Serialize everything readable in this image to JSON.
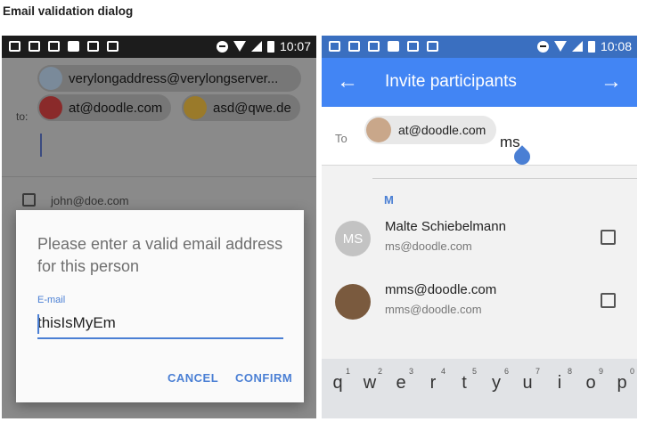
{
  "page_heading": "Email validation dialog",
  "left": {
    "status_time": "10:07",
    "chips": [
      "verylongaddress@verylongserver...",
      "at@doodle.com",
      "asd@qwe.de"
    ],
    "to_label": "to:",
    "background_email": "john@doe.com",
    "dialog": {
      "message": "Please enter a valid email address for this person",
      "field_label": "E-mail",
      "field_value": "thisIsMyEm",
      "cancel": "CANCEL",
      "confirm": "CONFIRM"
    }
  },
  "right": {
    "status_time": "10:08",
    "title": "Invite participants",
    "to_label": "To",
    "chip": "at@doodle.com",
    "typed_text": "ms",
    "section_letter": "M",
    "contacts": [
      {
        "initials": "MS",
        "name": "Malte Schiebelmann",
        "email": "ms@doodle.com"
      },
      {
        "initials": "",
        "name": "mms@doodle.com",
        "email": "mms@doodle.com"
      }
    ],
    "keys": [
      {
        "num": "1",
        "ch": "q"
      },
      {
        "num": "2",
        "ch": "w"
      },
      {
        "num": "3",
        "ch": "e"
      },
      {
        "num": "4",
        "ch": "r"
      },
      {
        "num": "5",
        "ch": "t"
      },
      {
        "num": "6",
        "ch": "y"
      },
      {
        "num": "7",
        "ch": "u"
      },
      {
        "num": "8",
        "ch": "i"
      },
      {
        "num": "9",
        "ch": "o"
      },
      {
        "num": "0",
        "ch": "p"
      }
    ]
  },
  "colors": {
    "accent": "#4285f4",
    "link": "#4a7fd4"
  }
}
